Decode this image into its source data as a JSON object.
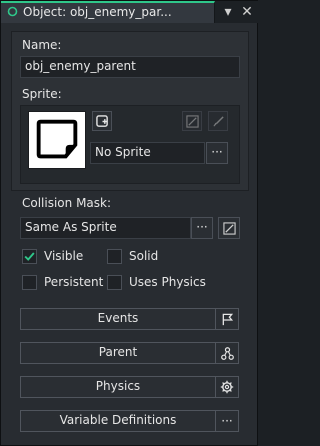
{
  "window": {
    "title": "Object: obj_enemy_par..."
  },
  "titlebar": {
    "pin_glyph": "▾",
    "close_glyph": "✕"
  },
  "name": {
    "label": "Name:",
    "value": "obj_enemy_parent"
  },
  "sprite": {
    "label": "Sprite:",
    "value": "No Sprite",
    "browse_label": "···"
  },
  "collision": {
    "label": "Collision Mask:",
    "value": "Same As Sprite",
    "browse_label": "···"
  },
  "options": {
    "visible": {
      "label": "Visible",
      "checked": true
    },
    "solid": {
      "label": "Solid",
      "checked": false
    },
    "persistent": {
      "label": "Persistent",
      "checked": false
    },
    "uses_physics": {
      "label": "Uses Physics",
      "checked": false
    }
  },
  "buttons": {
    "events": "Events",
    "parent": "Parent",
    "physics": "Physics",
    "variables": "Variable Definitions",
    "variables_more": "···"
  },
  "colors": {
    "accent": "#2fc78a",
    "check": "#2fc78a"
  }
}
